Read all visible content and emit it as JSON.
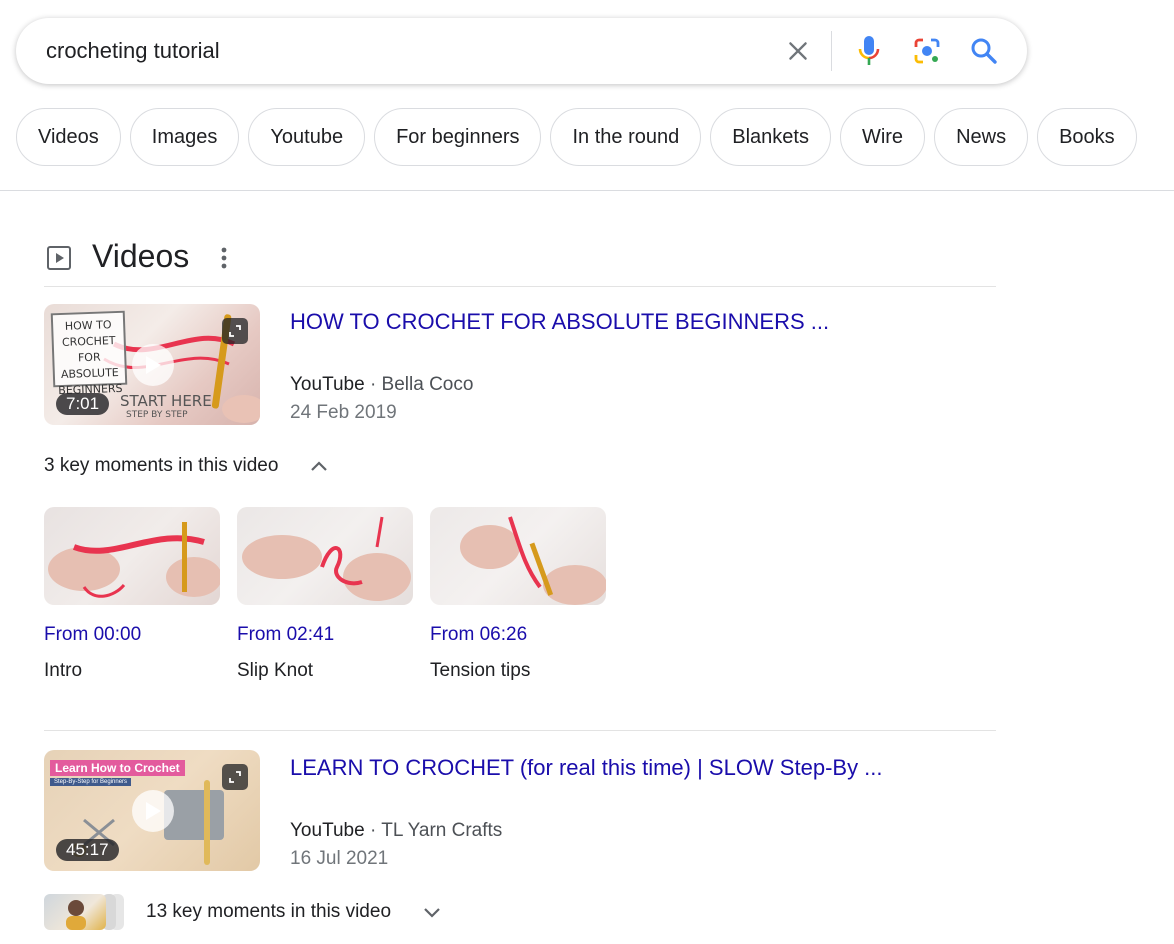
{
  "search": {
    "query": "crocheting tutorial"
  },
  "chips": [
    "Videos",
    "Images",
    "Youtube",
    "For beginners",
    "In the round",
    "Blankets",
    "Wire",
    "News",
    "Books"
  ],
  "section": {
    "title": "Videos"
  },
  "videos": [
    {
      "title": "HOW TO CROCHET FOR ABSOLUTE BEGINNERS ...",
      "source": "YouTube",
      "channel": "· Bella Coco",
      "date": "24 Feb 2019",
      "duration": "7:01",
      "thumb_text": [
        "HOW TO",
        "CROCHET FOR",
        "ABSOLUTE",
        "BEGINNERS"
      ],
      "thumb_start": "START HERE",
      "thumb_step": "STEP BY STEP",
      "key_moments_label": "3 key moments in this video",
      "key_moments_expanded": true,
      "moments": [
        {
          "from": "From 00:00",
          "label": "Intro"
        },
        {
          "from": "From 02:41",
          "label": "Slip Knot"
        },
        {
          "from": "From 06:26",
          "label": "Tension tips"
        }
      ]
    },
    {
      "title": "LEARN TO CROCHET (for real this time) | SLOW Step-By ...",
      "source": "YouTube",
      "channel": "· TL Yarn Crafts",
      "date": "16 Jul 2021",
      "duration": "45:17",
      "thumb_banner": "Learn How to Crochet",
      "thumb_sub": "Step-By-Step for Beginners",
      "key_moments_label": "13 key moments in this video",
      "key_moments_expanded": false
    }
  ],
  "colors": {
    "link": "#1a0dab",
    "text": "#202124",
    "meta": "#4d5156",
    "date": "#70757a",
    "border": "#dadce0",
    "google_blue": "#4285f4",
    "google_red": "#ea4335",
    "google_yellow": "#fbbc04",
    "google_green": "#34a853"
  }
}
